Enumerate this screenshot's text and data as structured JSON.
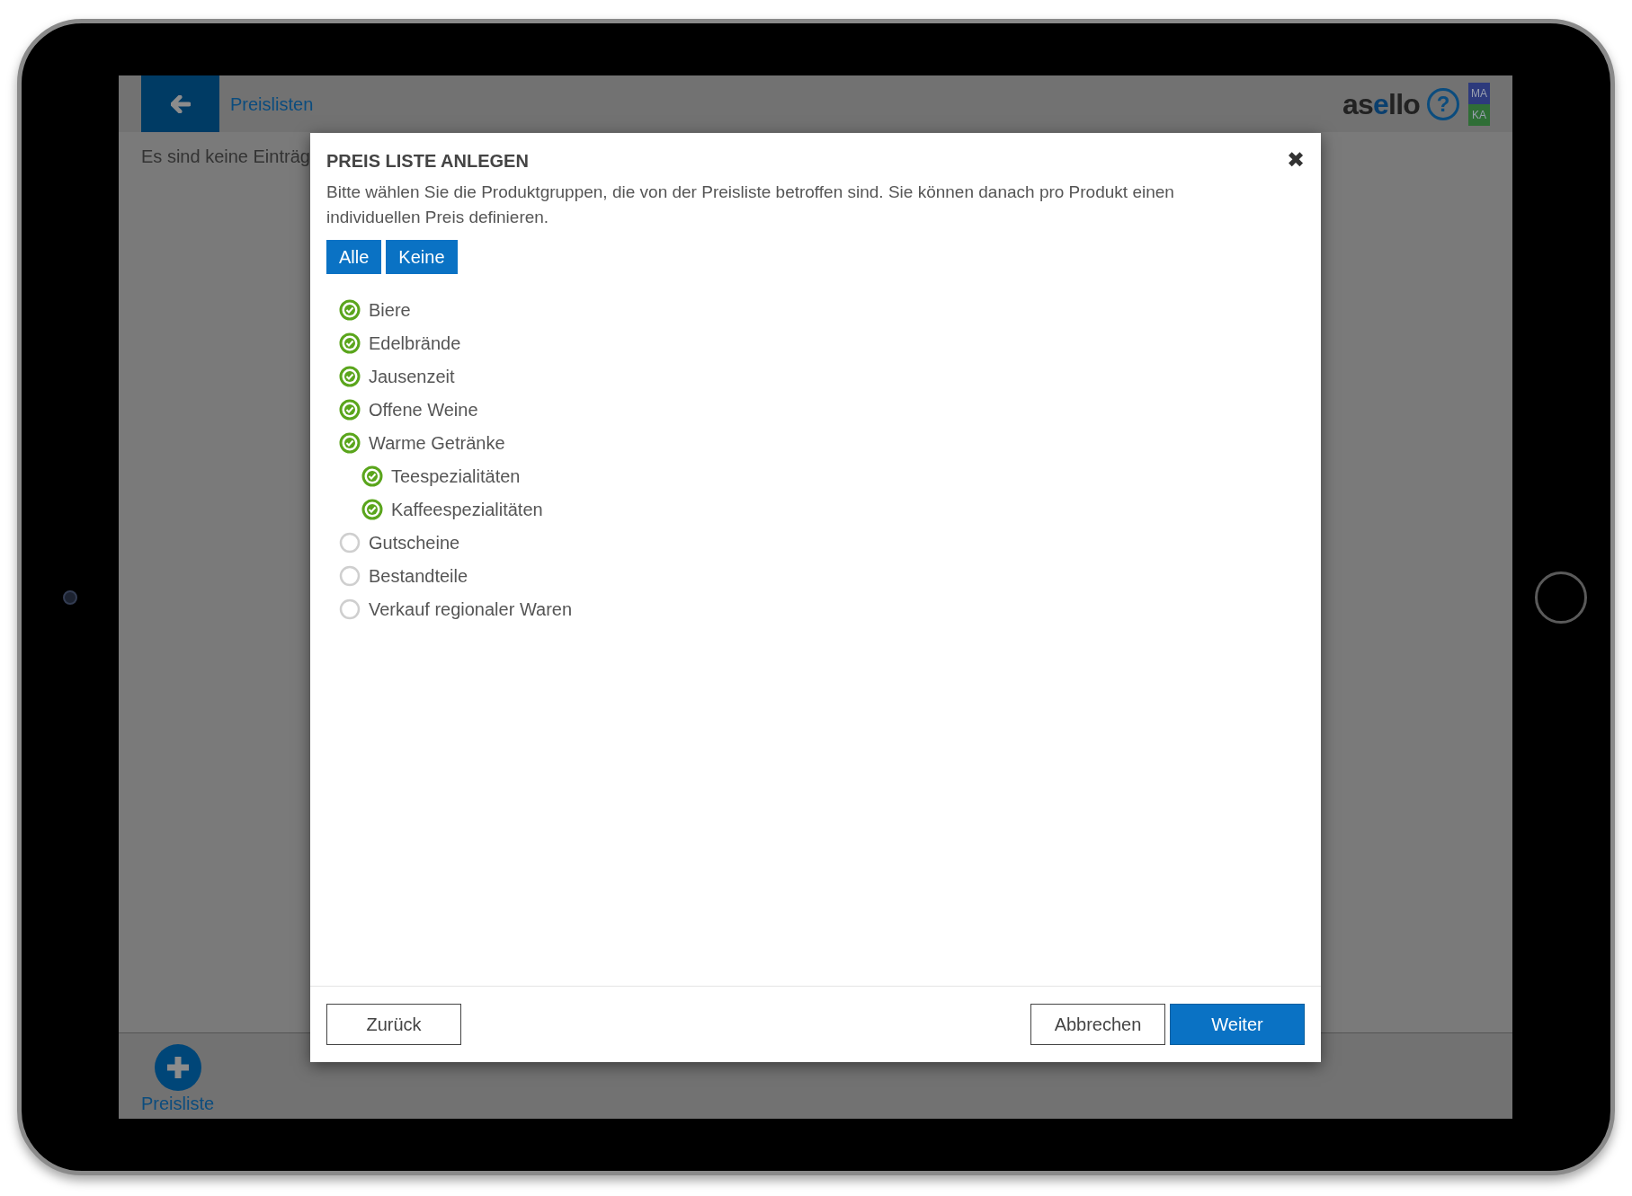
{
  "header": {
    "title": "Preislisten",
    "logo": {
      "part_1": "as",
      "part_2": "e",
      "part_3": "llo"
    },
    "help": "?",
    "user_badges": [
      {
        "label": "MA",
        "color": "#2d3a7c"
      },
      {
        "label": "KA",
        "color": "#2f6e36"
      }
    ]
  },
  "page": {
    "empty_message": "Es sind keine Einträg"
  },
  "bottom_bar": {
    "add_label": "Preisliste"
  },
  "dialog": {
    "title": "PREIS LISTE ANLEGEN",
    "close": "✖",
    "description": "Bitte wählen Sie die Produktgruppen, die von der Preisliste betroffen sind. Sie können danach pro Produkt einen individuellen Preis definieren.",
    "select_buttons": [
      "Alle",
      "Keine"
    ],
    "groups": [
      {
        "label": "Biere",
        "checked": true
      },
      {
        "label": "Edelbrände",
        "checked": true
      },
      {
        "label": "Jausenzeit",
        "checked": true
      },
      {
        "label": "Offene Weine",
        "checked": true
      },
      {
        "label": "Warme Getränke",
        "checked": true,
        "children": [
          {
            "label": "Teespezialitäten",
            "checked": true
          },
          {
            "label": "Kaffeespezialitäten",
            "checked": true
          }
        ]
      },
      {
        "label": "Gutscheine",
        "checked": false
      },
      {
        "label": "Bestandteile",
        "checked": false
      },
      {
        "label": "Verkauf regionaler Waren",
        "checked": false
      }
    ],
    "footer": {
      "back": "Zurück",
      "cancel": "Abbrechen",
      "next": "Weiter"
    }
  }
}
